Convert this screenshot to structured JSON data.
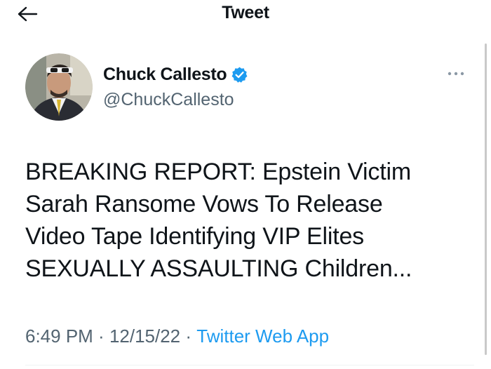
{
  "header": {
    "title": "Tweet"
  },
  "author": {
    "name": "Chuck Callesto",
    "handle": "@ChuckCallesto",
    "verified": true
  },
  "tweet": {
    "text": "BREAKING REPORT: Epstein Victim\nSarah Ransome Vows To Release\nVideo Tape Identifying VIP Elites\nSEXUALLY ASSAULTING Children...",
    "time": "6:49 PM",
    "separator": " · ",
    "date": "12/15/22",
    "source": "Twitter Web App"
  },
  "icons": {
    "back": "arrow-left-icon",
    "verified": "verified-badge-icon",
    "more": "more-horizontal-icon"
  },
  "colors": {
    "accent": "#1d9bf0",
    "text": "#0f1419",
    "secondary": "#536471"
  }
}
